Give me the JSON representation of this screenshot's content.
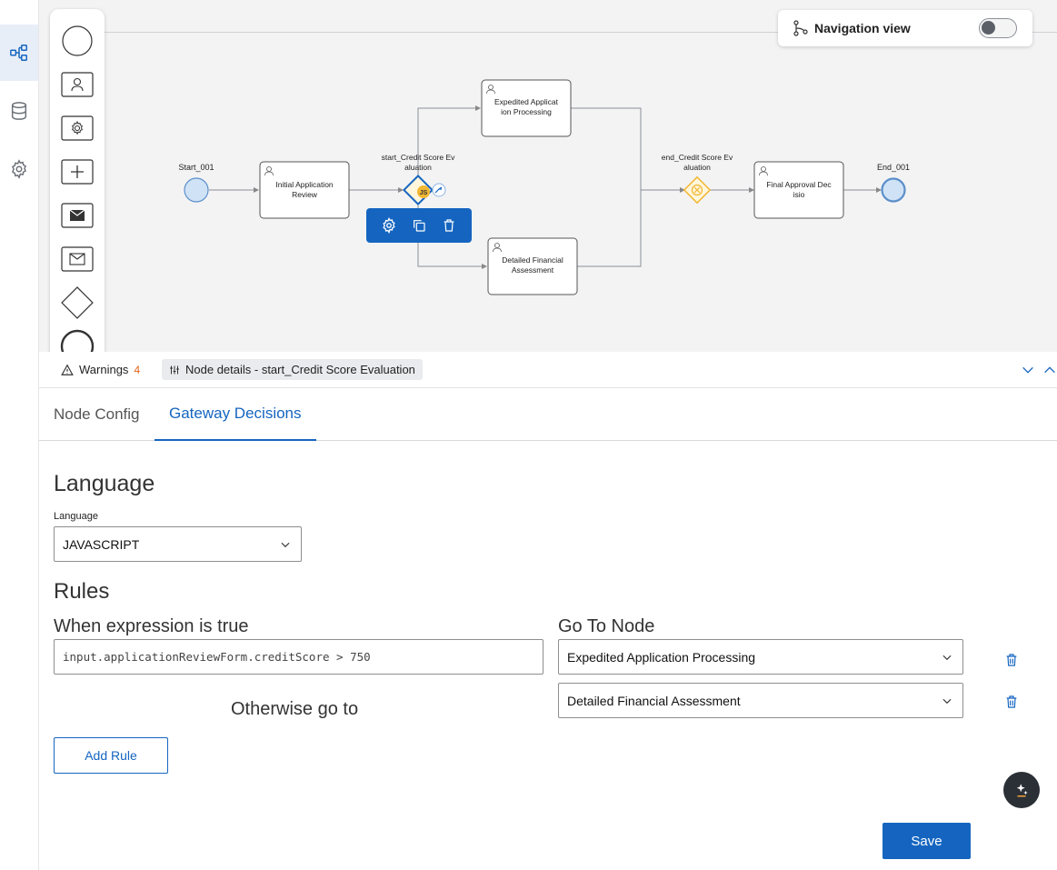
{
  "rail": {
    "items": [
      {
        "icon": "flow-diagram-icon",
        "active": true
      },
      {
        "icon": "database-icon",
        "active": false
      },
      {
        "icon": "gear-icon",
        "active": false
      }
    ]
  },
  "palette": {
    "items": [
      "start-event-icon",
      "user-task-icon",
      "service-task-icon",
      "subprocess-icon",
      "message-send-icon",
      "message-receive-icon",
      "gateway-icon",
      "end-event-icon"
    ]
  },
  "navigation_view": {
    "label": "Navigation view",
    "enabled": false
  },
  "diagram": {
    "nodes": {
      "start": {
        "label": "Start_001"
      },
      "initial_review": {
        "label_line1": "Initial Application",
        "label_line2": "Review"
      },
      "gateway_start": {
        "label_line1": "start_Credit Score Ev",
        "label_line2": "aluation",
        "badge": "JS"
      },
      "expedited": {
        "label_line1": "Expedited Applicat",
        "label_line2": "ion Processing"
      },
      "detailed": {
        "label_line1": "Detailed Financial",
        "label_line2": "Assessment"
      },
      "gateway_end": {
        "label_line1": "end_Credit Score Ev",
        "label_line2": "aluation"
      },
      "final": {
        "label_line1": "Final Approval Dec",
        "label_line2": "isio"
      },
      "end": {
        "label": "End_001"
      }
    }
  },
  "status_bar": {
    "warnings_label": "Warnings",
    "warnings_count": "4",
    "node_details_label": "Node details - start_Credit Score Evaluation"
  },
  "tabs": [
    {
      "label": "Node Config",
      "active": false
    },
    {
      "label": "Gateway Decisions",
      "active": true
    }
  ],
  "language_section": {
    "title": "Language",
    "field_label": "Language",
    "value": "JAVASCRIPT"
  },
  "rules_section": {
    "title": "Rules",
    "when_label": "When expression is true",
    "goto_label": "Go To Node",
    "rules": [
      {
        "expression": "input.applicationReviewForm.creditScore > 750",
        "target": "Expedited Application Processing"
      }
    ],
    "otherwise_label": "Otherwise go to",
    "otherwise_target": "Detailed Financial Assessment",
    "add_rule_label": "Add Rule"
  },
  "colors": {
    "accent": "#1565c0",
    "gateway_yellow": "#f2b632",
    "node_start": "#cfe2f6"
  },
  "save_label": "Save"
}
